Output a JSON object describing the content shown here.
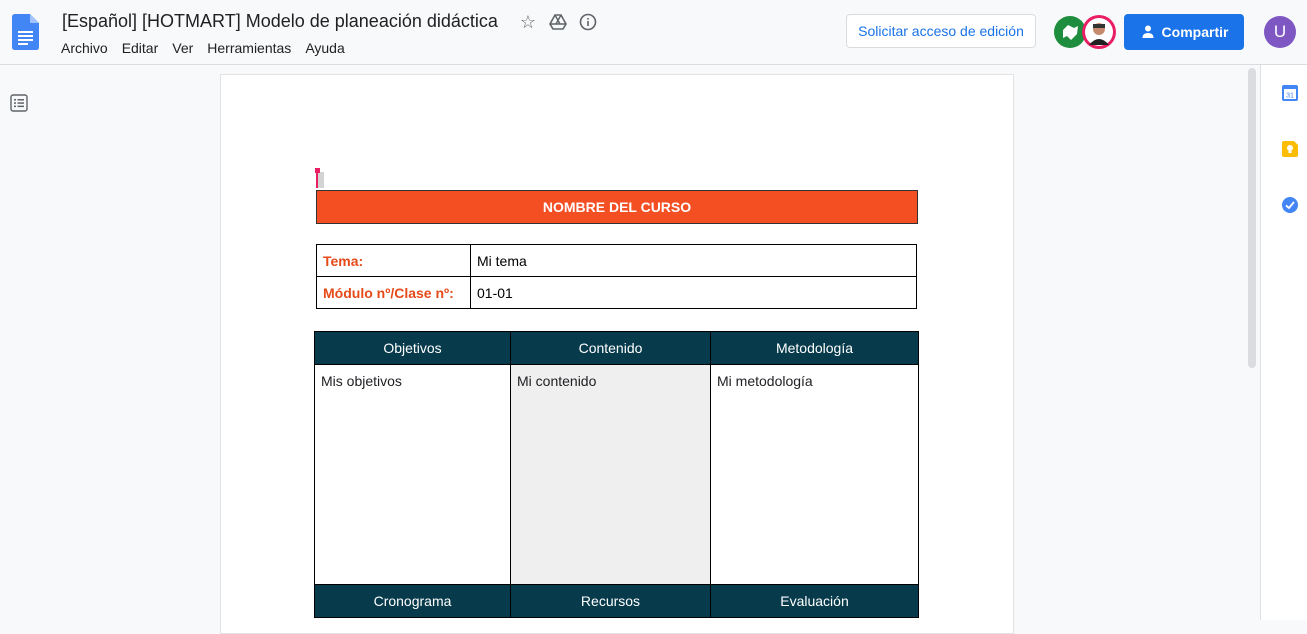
{
  "header": {
    "doc_title": "[Español] [HOTMART] Modelo de planeación didáctica",
    "menu": [
      "Archivo",
      "Editar",
      "Ver",
      "Herramientas",
      "Ayuda"
    ],
    "request_access_label": "Solicitar acceso de edición",
    "share_label": "Compartir",
    "user_initial": "U"
  },
  "document": {
    "course_title": "NOMBRE DEL CURSO",
    "info": [
      {
        "label": "Tema:",
        "value": "Mi tema"
      },
      {
        "label": "Módulo nº/Clase nº:",
        "value": "01-01"
      }
    ],
    "columns": [
      "Objetivos",
      "Contenido",
      "Metodología"
    ],
    "cells": [
      "Mis objetivos",
      "Mi contenido",
      "Mi metodología"
    ],
    "columns_bottom": [
      "Cronograma",
      "Recursos",
      "Evaluación"
    ]
  },
  "colors": {
    "accent": "#1a73e8",
    "course_title_bg": "#f44e23",
    "table_header_bg": "#073b4c",
    "label_color": "#e64a19"
  },
  "side_panel": {
    "icons": [
      "calendar-icon",
      "keep-icon",
      "tasks-icon"
    ],
    "calendar_text": "31"
  }
}
